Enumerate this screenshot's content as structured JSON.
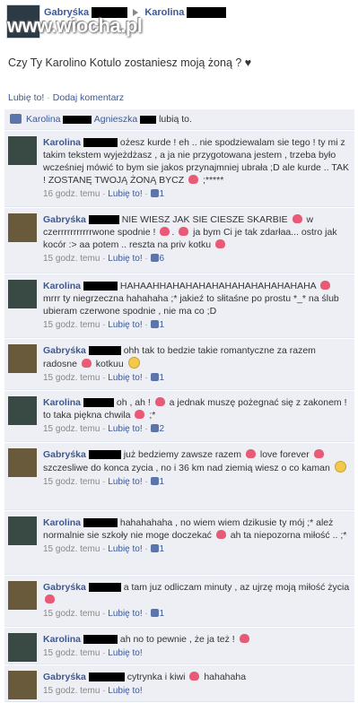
{
  "header": {
    "name1": "Gabryśka",
    "name2": "Karolina",
    "watermark": "www.wiocha.pl"
  },
  "status": "Czy Ty Karolino Kotulo zostaniesz moją żoną ? ♥",
  "actions": {
    "like": "Lubię to!",
    "separator": "·",
    "comment": "Dodaj komentarz"
  },
  "likes": {
    "name1": "Karolina",
    "name2": "Agnieszka",
    "suffix": "lubią to."
  },
  "meta_like": "Lubię to!",
  "comments": [
    {
      "author": "Karolina",
      "text_a": "ożesz kurde ! eh .. nie spodziewalam sie tego ! ty mi z takim tekstem wyjeżdżasz , a ja nie przygotowana jestem , trzeba było wcześniej mówić to bym sie jakos przynajmniej ubrała ;D ale kurde .. TAK ! ZOSTANĘ TWOJĄ ŻONĄ BYCZ",
      "text_b": ";*****",
      "time": "16 godz. temu",
      "likes": "1"
    },
    {
      "author": "Gabryśka",
      "text_a": "NIE WIESZ JAK SIE CIESZE SKARBIE",
      "text_b": "w czerrrrrrrrrrrwone spodnie !",
      "text_c": "ja bym Ci je tak zdarłaa... ostro jak kocór :> aa potem .. reszta na priv kotku",
      "time": "15 godz. temu",
      "likes": "6"
    },
    {
      "author": "Karolina",
      "text_a": "HAHAAHHAHAHAHAHAHAHAHAHAHAHAHA",
      "text_b": "mrrr ty niegrzeczna hahahaha ;* jakieź to słitaśne po prostu *_* na ślub ubieram czerwone spodnie , nie ma co ;D",
      "time": "15 godz. temu",
      "likes": "1"
    },
    {
      "author": "Gabryśka",
      "text_a": "ohh tak to bedzie takie romantyczne za razem radosne",
      "text_b": "kotkuu",
      "time": "15 godz. temu",
      "likes": "1"
    },
    {
      "author": "Karolina",
      "text_a": "oh , ah !",
      "text_b": "a jednak muszę pożegnać się z zakonem ! to taka piękna chwila",
      "text_c": ";*",
      "time": "15 godz. temu",
      "likes": "2"
    },
    {
      "author": "Gabryśka",
      "text_a": "już bedziemy zawsze razem",
      "text_b": "love forever",
      "text_c": "szczesliwe do konca zycia , no i 36 km nad ziemią wiesz o co kaman",
      "time": "15 godz. temu",
      "likes": "1"
    },
    {
      "author": "Karolina",
      "text_a": "hahahahaha , no wiem wiem dzikusie ty mój ;* ależ normalnie sie szkoły nie moge doczekać",
      "text_b": "ah ta niepozorna miłość .. ;*",
      "time": "15 godz. temu",
      "likes": "1"
    },
    {
      "author": "Gabryśka",
      "text_a": "a tam juz odliczam minuty , az ujrzę moją miłość życia",
      "time": "15 godz. temu",
      "likes": "1"
    },
    {
      "author": "Karolina",
      "text_a": "ah no to pewnie , że ja też !",
      "time": "15 godz. temu"
    },
    {
      "author": "Gabryśka",
      "text_a": "cytrynka i kiwi",
      "text_b": "hahahaha",
      "time": "15 godz. temu"
    }
  ],
  "colors": {
    "link": "#3b5998",
    "comment_bg": "#edeff4",
    "heart": "#e85a75"
  }
}
